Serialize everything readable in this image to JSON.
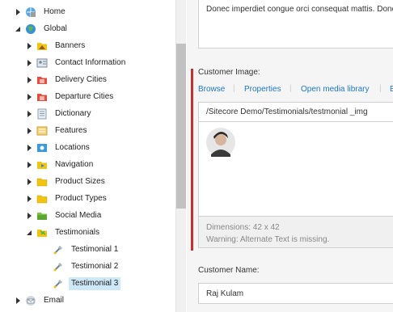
{
  "tree": {
    "items": [
      {
        "label": "Home",
        "icon": "home-globe-icon",
        "arrow": "collapsed",
        "indent": 0
      },
      {
        "label": "Global",
        "icon": "globe-icon",
        "arrow": "expanded",
        "indent": 0
      },
      {
        "label": "Banners",
        "icon": "folder-image-icon",
        "arrow": "collapsed",
        "indent": 1
      },
      {
        "label": "Contact Information",
        "icon": "contact-card-icon",
        "arrow": "collapsed",
        "indent": 1
      },
      {
        "label": "Delivery Cities",
        "icon": "city-folder-icon",
        "arrow": "collapsed",
        "indent": 1
      },
      {
        "label": "Departure Cities",
        "icon": "city-folder-icon",
        "arrow": "collapsed",
        "indent": 1
      },
      {
        "label": "Dictionary",
        "icon": "dictionary-icon",
        "arrow": "collapsed",
        "indent": 1
      },
      {
        "label": "Features",
        "icon": "features-icon",
        "arrow": "collapsed",
        "indent": 1
      },
      {
        "label": "Locations",
        "icon": "location-icon",
        "arrow": "collapsed",
        "indent": 1
      },
      {
        "label": "Navigation",
        "icon": "navigation-folder-icon",
        "arrow": "collapsed",
        "indent": 1
      },
      {
        "label": "Product Sizes",
        "icon": "yellow-folder-icon",
        "arrow": "collapsed",
        "indent": 1
      },
      {
        "label": "Product Types",
        "icon": "yellow-folder-icon",
        "arrow": "collapsed",
        "indent": 1
      },
      {
        "label": "Social Media",
        "icon": "green-folder-icon",
        "arrow": "collapsed",
        "indent": 1
      },
      {
        "label": "Testimonials",
        "icon": "testimonials-folder-icon",
        "arrow": "expanded",
        "indent": 1
      },
      {
        "label": "Testimonial 1",
        "icon": "testimonial-item-icon",
        "arrow": "none",
        "indent": 2
      },
      {
        "label": "Testimonial 2",
        "icon": "testimonial-item-icon",
        "arrow": "none",
        "indent": 2
      },
      {
        "label": "Testimonial 3",
        "icon": "testimonial-item-icon",
        "arrow": "none",
        "indent": 2,
        "selected": true
      },
      {
        "label": "Email",
        "icon": "email-icon",
        "arrow": "collapsed",
        "indent": 0
      }
    ]
  },
  "content": {
    "text_field_value": "Donec imperdiet congue orci consequat mattis. Donec",
    "image_field": {
      "label": "Customer Image:",
      "actions": [
        "Browse",
        "Properties",
        "Open media library",
        "E"
      ],
      "path": "/Sitecore Demo/Testimonials/testmonial _img",
      "dimensions": "Dimensions: 42 x 42",
      "warning": "Warning: Alternate Text is missing."
    },
    "name_field": {
      "label": "Customer Name:",
      "value": "Raj Kulam"
    }
  },
  "colors": {
    "accent_link": "#1b78c8",
    "error_bar": "#c4302b",
    "selected_row": "#cde8f7"
  }
}
